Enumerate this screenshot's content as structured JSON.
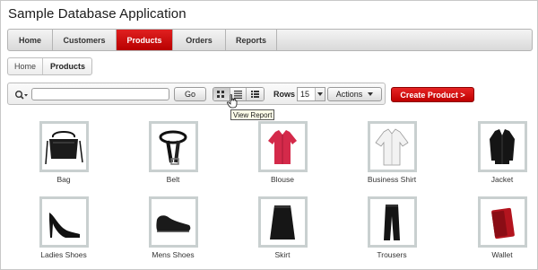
{
  "app": {
    "title": "Sample Database Application"
  },
  "nav": {
    "tabs": [
      {
        "label": "Home"
      },
      {
        "label": "Customers"
      },
      {
        "label": "Products"
      },
      {
        "label": "Orders"
      },
      {
        "label": "Reports"
      }
    ],
    "active_tab": "Products"
  },
  "breadcrumb": {
    "items": [
      "Home",
      "Products"
    ]
  },
  "toolbar": {
    "search_value": "",
    "go_label": "Go",
    "rows_label": "Rows",
    "rows_value": "15",
    "actions_label": "Actions",
    "view_modes": [
      "grid-view-icon",
      "report-view-icon",
      "detail-view-icon"
    ],
    "active_view": "grid-view-icon"
  },
  "create_button": {
    "label": "Create Product >"
  },
  "tooltip": {
    "text": "View Report"
  },
  "products": [
    {
      "name": "Bag",
      "icon": "bag-icon"
    },
    {
      "name": "Belt",
      "icon": "belt-icon"
    },
    {
      "name": "Blouse",
      "icon": "blouse-icon"
    },
    {
      "name": "Business Shirt",
      "icon": "shirt-icon"
    },
    {
      "name": "Jacket",
      "icon": "jacket-icon"
    },
    {
      "name": "Ladies Shoes",
      "icon": "heel-shoe-icon"
    },
    {
      "name": "Mens Shoes",
      "icon": "mens-shoe-icon"
    },
    {
      "name": "Skirt",
      "icon": "skirt-icon"
    },
    {
      "name": "Trousers",
      "icon": "trousers-icon"
    },
    {
      "name": "Wallet",
      "icon": "wallet-icon"
    }
  ],
  "colors": {
    "accent": "#cc0000",
    "thumb_border": "#c9d0d0"
  }
}
